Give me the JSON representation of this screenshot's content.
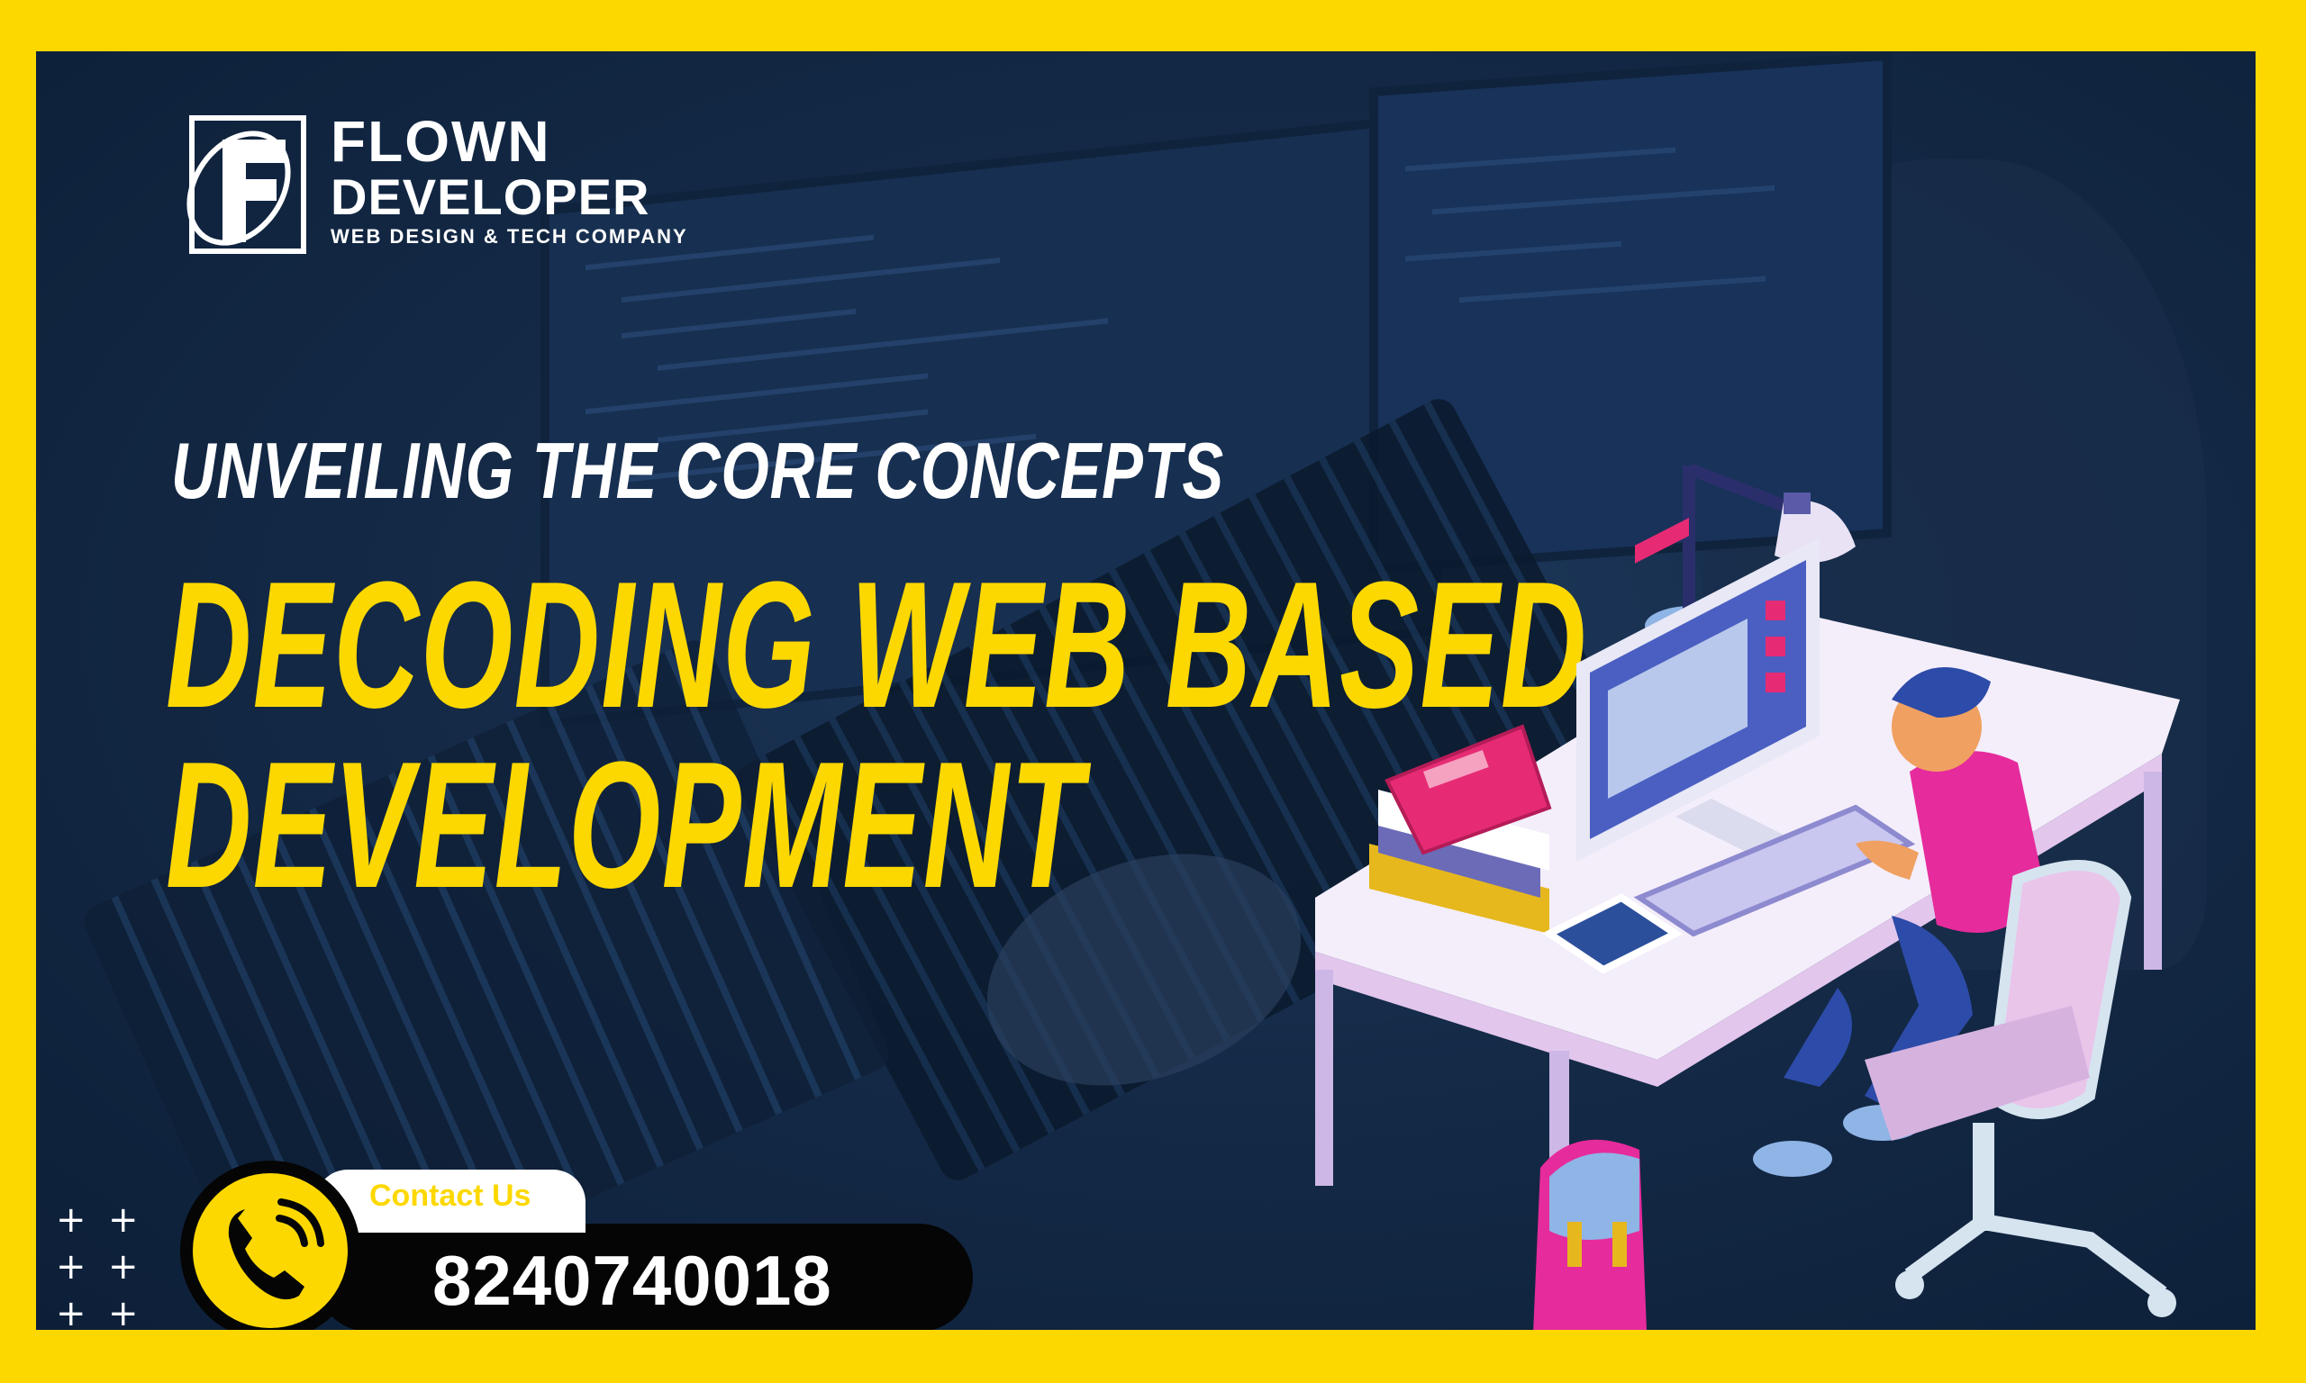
{
  "brand": {
    "name_line1": "FLOWN",
    "name_line2": "DEVELOPER",
    "tagline": "WEB DESIGN & TECH COMPANY",
    "logo_icon": "F-monogram-logo"
  },
  "headline": {
    "subtitle": "UNVEILING THE CORE CONCEPTS",
    "title_line1": "DECODING WEB BASED",
    "title_line2": "DEVELOPMENT"
  },
  "contact": {
    "label": "Contact Us",
    "phone": "8240740018",
    "icon": "phone-icon"
  },
  "decor": {
    "plus_symbol": "+",
    "illustration": "developer-at-desk-illustration"
  },
  "colors": {
    "frame": "#fdd800",
    "panel": "#142a47",
    "accent": "#fdd800",
    "text": "#ffffff",
    "bar": "#050505"
  }
}
